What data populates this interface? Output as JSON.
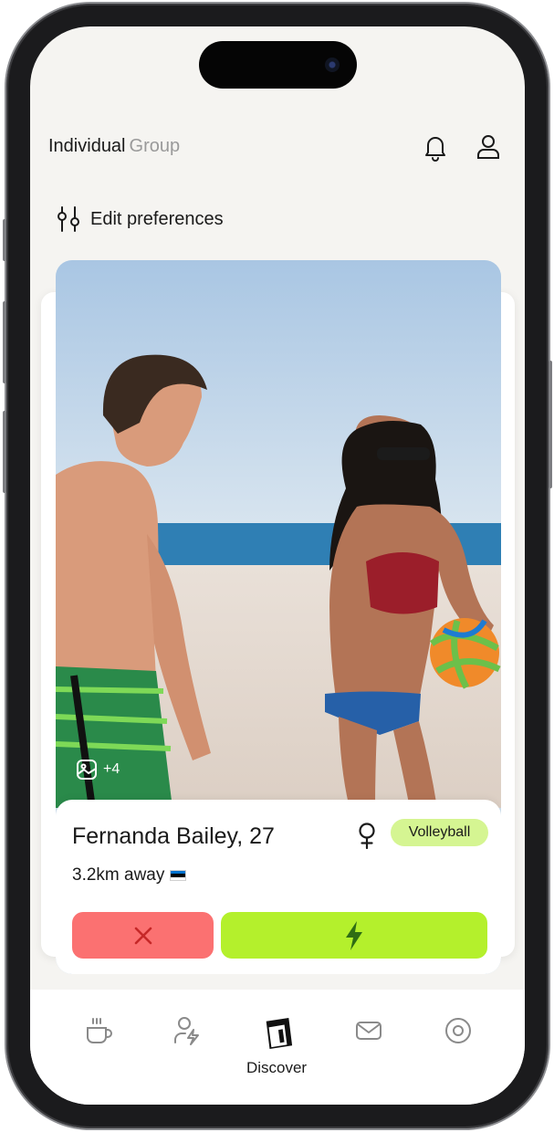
{
  "header": {
    "tab_active": "Individual",
    "tab_inactive": "Group",
    "icons": [
      "bell-icon",
      "profile-icon"
    ]
  },
  "preferences": {
    "label": "Edit preferences",
    "icon": "sliders-icon"
  },
  "profile_card": {
    "photo_count": "+4",
    "name_age": "Fernanda Bailey, 27",
    "gender_icon": "female-symbol-icon",
    "sport_badge": "Volleyball",
    "distance": "3.2km away",
    "flag_colors": [
      "#0072ce",
      "#000000",
      "#ffffff"
    ],
    "actions": {
      "pass_icon": "close-icon",
      "like_icon": "lightning-icon"
    }
  },
  "tab_bar": {
    "tabs": [
      {
        "icon": "coffee-cup-icon"
      },
      {
        "icon": "user-lightning-icon"
      },
      {
        "icon": "discover-icon",
        "label": "Discover",
        "active": true
      },
      {
        "icon": "mail-icon"
      },
      {
        "icon": "target-icon"
      }
    ]
  },
  "colors": {
    "pass_button": "#fb7171",
    "like_button": "#b4f02c",
    "badge": "#d5f592",
    "background": "#f5f4f1"
  }
}
